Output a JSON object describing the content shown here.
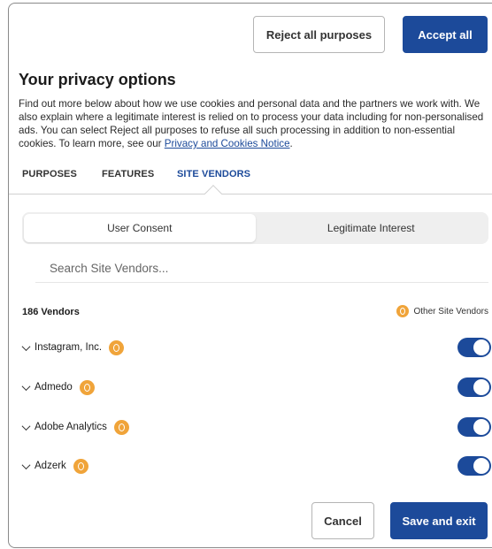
{
  "actions": {
    "reject_all": "Reject all purposes",
    "accept_all": "Accept all",
    "cancel": "Cancel",
    "save_exit": "Save and exit"
  },
  "header": {
    "title": "Your privacy options",
    "description": "Find out more below about how we use cookies and personal data and the partners we work with. We also explain where a legitimate interest is relied on to process your data including for non-personalised ads. You can select Reject all purposes to refuse all such processing in addition to non-essential cookies. To learn more, see our ",
    "notice_link": "Privacy and Cookies Notice",
    "description_end": "."
  },
  "tabs": [
    {
      "label": "PURPOSES",
      "active": false
    },
    {
      "label": "FEATURES",
      "active": false
    },
    {
      "label": "SITE VENDORS",
      "active": true
    }
  ],
  "segment": {
    "user_consent": "User Consent",
    "legitimate_interest": "Legitimate Interest",
    "selected": "User Consent"
  },
  "search": {
    "placeholder": "Search Site Vendors..."
  },
  "vendors": {
    "count_label": "186 Vendors",
    "legend_label": "Other Site Vendors",
    "items": [
      {
        "name": "Instagram, Inc.",
        "enabled": true
      },
      {
        "name": "Admedo",
        "enabled": true
      },
      {
        "name": "Adobe Analytics",
        "enabled": true
      },
      {
        "name": "Adzerk",
        "enabled": true
      }
    ]
  },
  "colors": {
    "primary": "#1c4a9a",
    "badge": "#f0a43a"
  }
}
